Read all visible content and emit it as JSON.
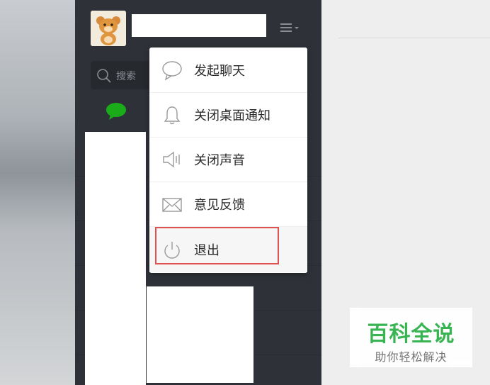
{
  "search": {
    "placeholder": "搜索"
  },
  "menu": {
    "items": [
      {
        "label": "发起聊天",
        "icon": "chat-bubble-icon"
      },
      {
        "label": "关闭桌面通知",
        "icon": "bell-icon"
      },
      {
        "label": "关闭声音",
        "icon": "speaker-icon"
      },
      {
        "label": "意见反馈",
        "icon": "envelope-icon"
      },
      {
        "label": "退出",
        "icon": "power-icon"
      }
    ]
  },
  "watermark": {
    "title": "百科全说",
    "subtitle": "助你轻松解决"
  },
  "colors": {
    "sidebar_bg": "#2e3238",
    "accent_green": "#1aad19",
    "highlight_red": "#e05252",
    "watermark_green": "#2fb24a"
  }
}
